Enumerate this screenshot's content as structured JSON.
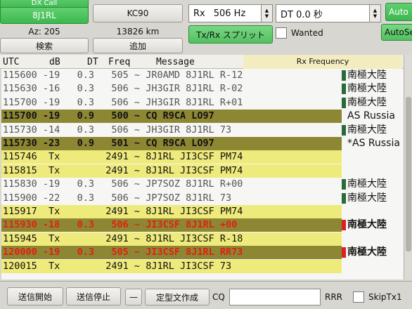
{
  "top": {
    "dx_call_label": "DX Call",
    "dx_call_value": "8J1RL",
    "dx_grid_value": "KC90",
    "az_label": "Az: 205",
    "distance_label": "13826 km",
    "lookup_button": "検索",
    "add_button": "追加",
    "rx_freq_label": "Rx",
    "rx_freq_value": "506 Hz",
    "dt_value": "DT 0.0 秒",
    "split_button": "Tx/Rx スプリット",
    "wanted_label": "Wanted",
    "auto_seq_label": "Auto",
    "auto_seq2_label": "AutoSe"
  },
  "table": {
    "headers": {
      "utc": "UTC",
      "db": "dB",
      "dt": "DT",
      "freq": "Freq",
      "message": "Message",
      "rx_frequency": "Rx Frequency"
    },
    "rows": [
      {
        "utc": "115600",
        "db": "-19",
        "dt": "0.3",
        "freq": "505",
        "msg": "JR0AMD 8J1RL R-12",
        "country": "南極大陸",
        "style": "",
        "mark": "green"
      },
      {
        "utc": "115630",
        "db": "-16",
        "dt": "0.3",
        "freq": "506",
        "msg": "JH3GIR 8J1RL R-02",
        "country": "南極大陸",
        "style": "",
        "mark": "green"
      },
      {
        "utc": "115700",
        "db": "-19",
        "dt": "0.3",
        "freq": "506",
        "msg": "JH3GIR 8J1RL R+01",
        "country": "南極大陸",
        "style": "",
        "mark": "green"
      },
      {
        "utc": "115700",
        "db": "-19",
        "dt": "0.9",
        "freq": "500",
        "msg": "CQ R9CA LO97",
        "country": "AS Russia",
        "style": "olive",
        "mark": ""
      },
      {
        "utc": "115730",
        "db": "-14",
        "dt": "0.3",
        "freq": "506",
        "msg": "JH3GIR 8J1RL 73",
        "country": "南極大陸",
        "style": "",
        "mark": "green"
      },
      {
        "utc": "115730",
        "db": "-23",
        "dt": "0.9",
        "freq": "501",
        "msg": "CQ R9CA LO97",
        "country": "*AS Russia",
        "style": "olive",
        "mark": ""
      },
      {
        "utc": "115746",
        "db": "Tx",
        "dt": "",
        "freq": "2491",
        "msg": "8J1RL JI3CSF PM74",
        "country": "",
        "style": "yellow",
        "mark": ""
      },
      {
        "utc": "115815",
        "db": "Tx",
        "dt": "",
        "freq": "2491",
        "msg": "8J1RL JI3CSF PM74",
        "country": "",
        "style": "yellow",
        "mark": ""
      },
      {
        "utc": "115830",
        "db": "-19",
        "dt": "0.3",
        "freq": "506",
        "msg": "JP7SOZ 8J1RL R+00",
        "country": "南極大陸",
        "style": "",
        "mark": "green"
      },
      {
        "utc": "115900",
        "db": "-22",
        "dt": "0.3",
        "freq": "506",
        "msg": "JP7SOZ 8J1RL 73",
        "country": "南極大陸",
        "style": "",
        "mark": "green"
      },
      {
        "utc": "115917",
        "db": "Tx",
        "dt": "",
        "freq": "2491",
        "msg": "8J1RL JI3CSF PM74",
        "country": "",
        "style": "yellow",
        "mark": ""
      },
      {
        "utc": "115930",
        "db": "-18",
        "dt": "0.3",
        "freq": "506",
        "msg": "JI3CSF 8J1RL +00",
        "country": "南極大陸",
        "style": "olive red",
        "mark": "red"
      },
      {
        "utc": "115945",
        "db": "Tx",
        "dt": "",
        "freq": "2491",
        "msg": "8J1RL JI3CSF R-18",
        "country": "",
        "style": "yellow",
        "mark": ""
      },
      {
        "utc": "120000",
        "db": "-19",
        "dt": "0.3",
        "freq": "505",
        "msg": "JI3CSF 8J1RL RR73",
        "country": "南極大陸",
        "style": "olive red",
        "mark": "red"
      },
      {
        "utc": "120015",
        "db": "Tx",
        "dt": "",
        "freq": "2491",
        "msg": "8J1RL JI3CSF 73",
        "country": "",
        "style": "yellow",
        "mark": ""
      }
    ]
  },
  "bottom": {
    "tx_enable_button": "送信開始",
    "tx_halt_button": "送信停止",
    "dash_button": "—",
    "macro_button": "定型文作成",
    "cq_label": "CQ",
    "cq_value": "",
    "rrr_label": "RRR",
    "skiptx_label": "SkipTx1"
  },
  "colors": {
    "olive_row": "#8d8734",
    "tx_row": "#eeea7c",
    "decode_red": "#e02010",
    "green_button": "#3cb84e"
  }
}
